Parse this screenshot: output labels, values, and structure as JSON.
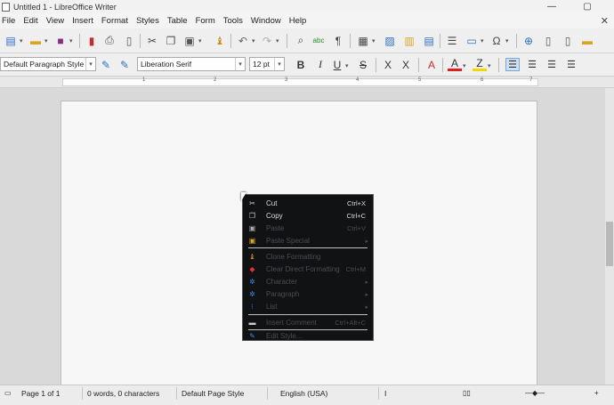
{
  "window": {
    "title": "Untitled 1 - LibreOffice Writer",
    "minimize_glyph": "—",
    "restore_glyph": "▢"
  },
  "menubar": {
    "items": [
      "File",
      "Edit",
      "View",
      "Insert",
      "Format",
      "Styles",
      "Table",
      "Form",
      "Tools",
      "Window",
      "Help"
    ],
    "close_glyph": "✕"
  },
  "toolbar_standard": {
    "icons": [
      "new-document-icon",
      "open-icon",
      "save-icon",
      "export-pdf-icon",
      "print-icon",
      "print-preview-icon",
      "cut-icon",
      "copy-icon",
      "paste-icon",
      "clone-formatting-icon",
      "undo-icon",
      "redo-icon",
      "find-replace-icon",
      "spelling-icon",
      "formatting-marks-icon",
      "insert-table-icon",
      "insert-image-icon",
      "insert-chart-icon",
      "insert-textbox-icon",
      "page-break-icon",
      "insert-field-icon",
      "special-character-icon",
      "hyperlink-icon",
      "footnote-icon",
      "comment-icon"
    ]
  },
  "toolbar_formatting": {
    "paragraph_style": "Default Paragraph Style",
    "font_name": "Liberation Serif",
    "font_size": "12 pt",
    "bold": "B",
    "italic": "I",
    "underline": "U",
    "strikethrough": "S",
    "superscript": "X",
    "subscript": "X",
    "font_color": "A",
    "highlight": "Z",
    "colors": {
      "font_color_bar": "#e02020",
      "highlight_bar": "#f2d600",
      "accent": "#2a7be0"
    }
  },
  "ruler": {
    "numbers": [
      "1",
      "2",
      "3",
      "4",
      "5",
      "6",
      "7"
    ]
  },
  "context_menu": {
    "items": [
      {
        "label": "Cut",
        "shortcut": "Ctrl+X",
        "icon": "scissors-icon",
        "enabled": true
      },
      {
        "label": "Copy",
        "shortcut": "Ctrl+C",
        "icon": "copy-icon",
        "enabled": true
      },
      {
        "label": "Paste",
        "shortcut": "Ctrl+V",
        "icon": "paste-icon",
        "enabled": false
      },
      {
        "label": "Paste Special",
        "shortcut": "",
        "icon": "paste-special-icon",
        "enabled": false
      },
      {
        "label": "Clone Formatting",
        "shortcut": "",
        "icon": "paintbrush-icon",
        "enabled": false
      },
      {
        "label": "Clear Direct Formatting",
        "shortcut": "Ctrl+M",
        "icon": "eraser-icon",
        "enabled": false
      },
      {
        "label": "Character",
        "shortcut": "",
        "icon": "character-icon",
        "enabled": false
      },
      {
        "label": "Paragraph",
        "shortcut": "",
        "icon": "paragraph-icon",
        "enabled": false
      },
      {
        "label": "List",
        "shortcut": "",
        "icon": "list-icon",
        "enabled": false
      },
      {
        "label": "Insert Comment",
        "shortcut": "Ctrl+Alt+C",
        "icon": "comment-icon",
        "enabled": false
      },
      {
        "label": "Edit Style...",
        "shortcut": "",
        "icon": "edit-style-icon",
        "enabled": false
      }
    ]
  },
  "statusbar": {
    "page": "Page 1 of 1",
    "words": "0 words, 0 characters",
    "page_style": "Default Page Style",
    "language": "English (USA)",
    "insert_mode": "I"
  }
}
